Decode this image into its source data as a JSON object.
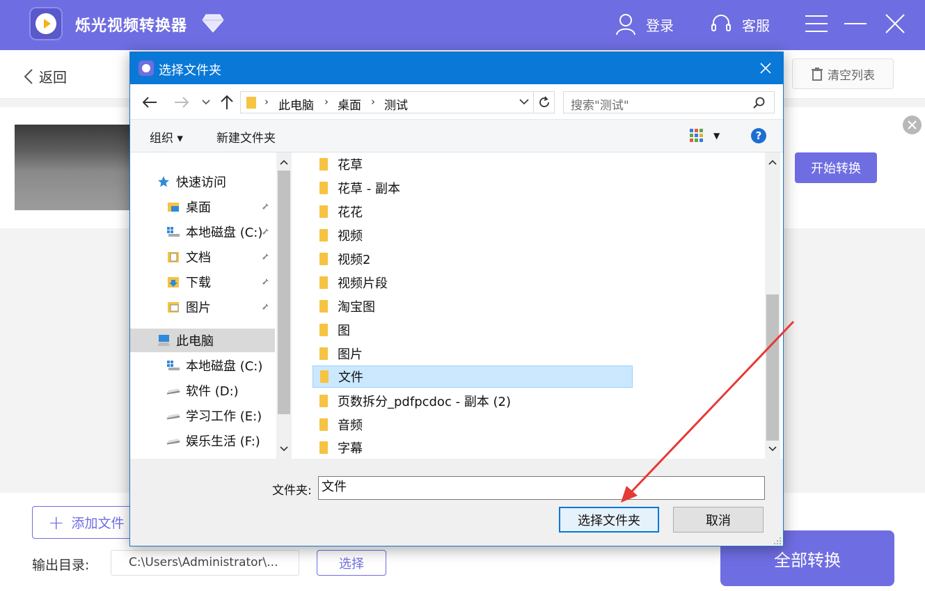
{
  "app": {
    "title": "烁光视频转换器",
    "login_label": "登录",
    "service_label": "客服",
    "back_label": "返回",
    "clear_list_label": "清空列表",
    "start_convert_label": "开始转换",
    "add_file_label": "添加文件",
    "output_dir_label": "输出目录:",
    "output_path": "C:\\Users\\Administrator\\...",
    "choose_label": "选择",
    "convert_all_label": "全部转换",
    "accent_color": "#6f6de2"
  },
  "dialog": {
    "title": "选择文件夹",
    "breadcrumb": [
      "此电脑",
      "桌面",
      "测试"
    ],
    "search_placeholder": "搜索\"测试\"",
    "organize_label": "组织",
    "new_folder_label": "新建文件夹",
    "help_label": "?",
    "nav": {
      "quick_access": "快速访问",
      "quick_items": [
        "桌面",
        "本地磁盘 (C:)",
        "文档",
        "下载",
        "图片"
      ],
      "this_pc": "此电脑",
      "drives": [
        "本地磁盘 (C:)",
        "软件 (D:)",
        "学习工作 (E:)",
        "娱乐生活 (F:)"
      ]
    },
    "folders": [
      "花草",
      "花草 - 副本",
      "花花",
      "视频",
      "视频2",
      "视频片段",
      "淘宝图",
      "图",
      "图片",
      "文件",
      "页数拆分_pdfpcdoc - 副本 (2)",
      "音频",
      "字幕"
    ],
    "selected_folder": "文件",
    "folder_field_label": "文件夹:",
    "folder_field_value": "文件",
    "select_button_label": "选择文件夹",
    "cancel_button_label": "取消",
    "title_bar_color": "#0a78d7",
    "selection_color": "#cce8ff"
  },
  "annotation": {
    "arrow_color": "#e53935"
  }
}
